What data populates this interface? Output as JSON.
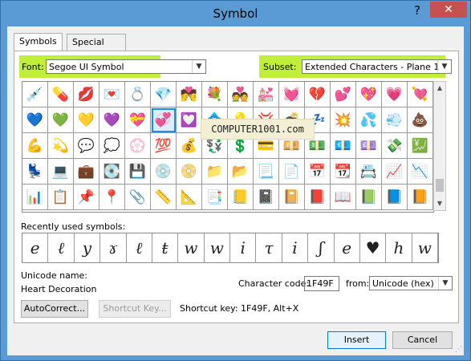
{
  "window": {
    "title": "Symbol",
    "help": "?",
    "close": "✕"
  },
  "tabs": {
    "symbols": "Symbols",
    "special": "Special Characters"
  },
  "font": {
    "label": "Font:",
    "value": "Segoe UI Symbol"
  },
  "subset": {
    "label": "Subset:",
    "value": "Extended Characters - Plane 1"
  },
  "watermark": "COMPUTER1001.com",
  "grid": {
    "selected_index": 21,
    "symbols": [
      "💉",
      "💊",
      "💋",
      "💌",
      "💍",
      "💎",
      "💏",
      "💐",
      "💑",
      "💒",
      "💓",
      "💔",
      "💕",
      "💖",
      "💗",
      "💘",
      "💙",
      "💚",
      "💛",
      "💜",
      "💝",
      "💞",
      "💟",
      "💠",
      "💡",
      "💢",
      "💣",
      "💤",
      "💥",
      "💦",
      "💨",
      "💩",
      "💪",
      "💫",
      "💬",
      "💭",
      "💮",
      "💯",
      "💰",
      "💱",
      "💲",
      "💳",
      "💴",
      "💵",
      "💶",
      "💷",
      "💸",
      "💹",
      "💺",
      "💻",
      "💼",
      "💽",
      "💾",
      "💿",
      "📀",
      "📁",
      "📂",
      "📃",
      "📄",
      "📅",
      "📆",
      "📇",
      "📈",
      "📉",
      "📊",
      "📋",
      "📌",
      "📍",
      "📎",
      "📏",
      "📐",
      "📑",
      "📒",
      "📓",
      "📔",
      "📕",
      "📖",
      "📗",
      "📘",
      "📙"
    ]
  },
  "recent": {
    "label": "Recently used symbols:",
    "symbols": [
      "e",
      "ℓ",
      "y",
      "ɤ",
      "ℓ",
      "ŧ",
      "w",
      "w",
      "i",
      "τ",
      "i",
      "ʃ",
      "e",
      "♥",
      "h",
      "w"
    ]
  },
  "unicode": {
    "label": "Unicode name:",
    "name": "Heart Decoration"
  },
  "charcode": {
    "label": "Character code:",
    "value": "1F49F",
    "from_label": "from:",
    "from_value": "Unicode (hex)"
  },
  "buttons": {
    "autocorrect": "AutoCorrect...",
    "shortcut_key": "Shortcut Key...",
    "insert": "Insert",
    "cancel": "Cancel"
  },
  "shortcut": {
    "text": "Shortcut key: 1F49F, Alt+X"
  }
}
